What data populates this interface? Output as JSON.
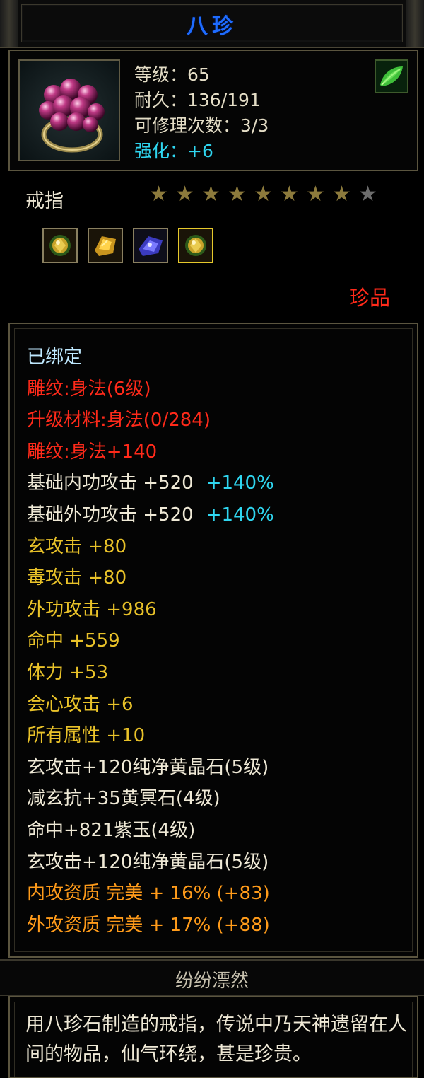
{
  "item": {
    "name": "八珍",
    "level_line": "等级：65",
    "durability_line": "耐久：136/191",
    "repair_line": "可修理次数：3/3",
    "enhance_line": "强化：+6",
    "type": "戒指",
    "stars_total": 9,
    "stars_lit": 8,
    "grade": "珍品",
    "icon": "grape-cluster-ring-icon",
    "corner_icon": "green-leaf-icon",
    "gems": [
      {
        "icon": "yellow-crystal-gem-icon",
        "active": false
      },
      {
        "icon": "gold-shard-gem-icon",
        "active": false
      },
      {
        "icon": "purple-jade-gem-icon",
        "active": false
      },
      {
        "icon": "yellow-crystal-gem-icon",
        "active": true
      }
    ]
  },
  "stats": [
    {
      "text": "已绑定",
      "color": "bound"
    },
    {
      "text": "雕纹:身法(6级)",
      "color": "red"
    },
    {
      "text": "升级材料:身法(0/284)",
      "color": "red"
    },
    {
      "text": "雕纹:身法+140",
      "color": "red"
    },
    {
      "text": "基础内功攻击  +520",
      "extra": "+140%",
      "color": "white"
    },
    {
      "text": "基础外功攻击  +520",
      "extra": "+140%",
      "color": "white"
    },
    {
      "text": "玄攻击  +80",
      "color": "gold"
    },
    {
      "text": "毒攻击  +80",
      "color": "gold"
    },
    {
      "text": "外功攻击  +986",
      "color": "gold"
    },
    {
      "text": "命中  +559",
      "color": "gold"
    },
    {
      "text": "体力  +53",
      "color": "gold"
    },
    {
      "text": "会心攻击  +6",
      "color": "gold"
    },
    {
      "text": "所有属性  +10",
      "color": "gold"
    },
    {
      "text": "玄攻击+120纯净黄晶石(5级)",
      "color": "white"
    },
    {
      "text": "减玄抗+35黄冥石(4级)",
      "color": "white"
    },
    {
      "text": "命中+821紫玉(4级)",
      "color": "white"
    },
    {
      "text": "玄攻击+120纯净黄晶石(5级)",
      "color": "white"
    },
    {
      "text": "内攻资质  完美  +  16% (+83)",
      "color": "orange"
    },
    {
      "text": "外攻资质  完美  +  17% (+88)",
      "color": "orange"
    }
  ],
  "set_name": "纷纷漂然",
  "description": "用八珍石制造的戒指，传说中乃天神遗留在人间的物品，仙气环绕，甚是珍贵。",
  "colors": {
    "title": "#1e6cff",
    "enhance": "#2fd6f0",
    "red": "#ff2a1a",
    "gold": "#e9c229",
    "orange": "#ff9b1a",
    "cyan": "#2fd6f0"
  }
}
